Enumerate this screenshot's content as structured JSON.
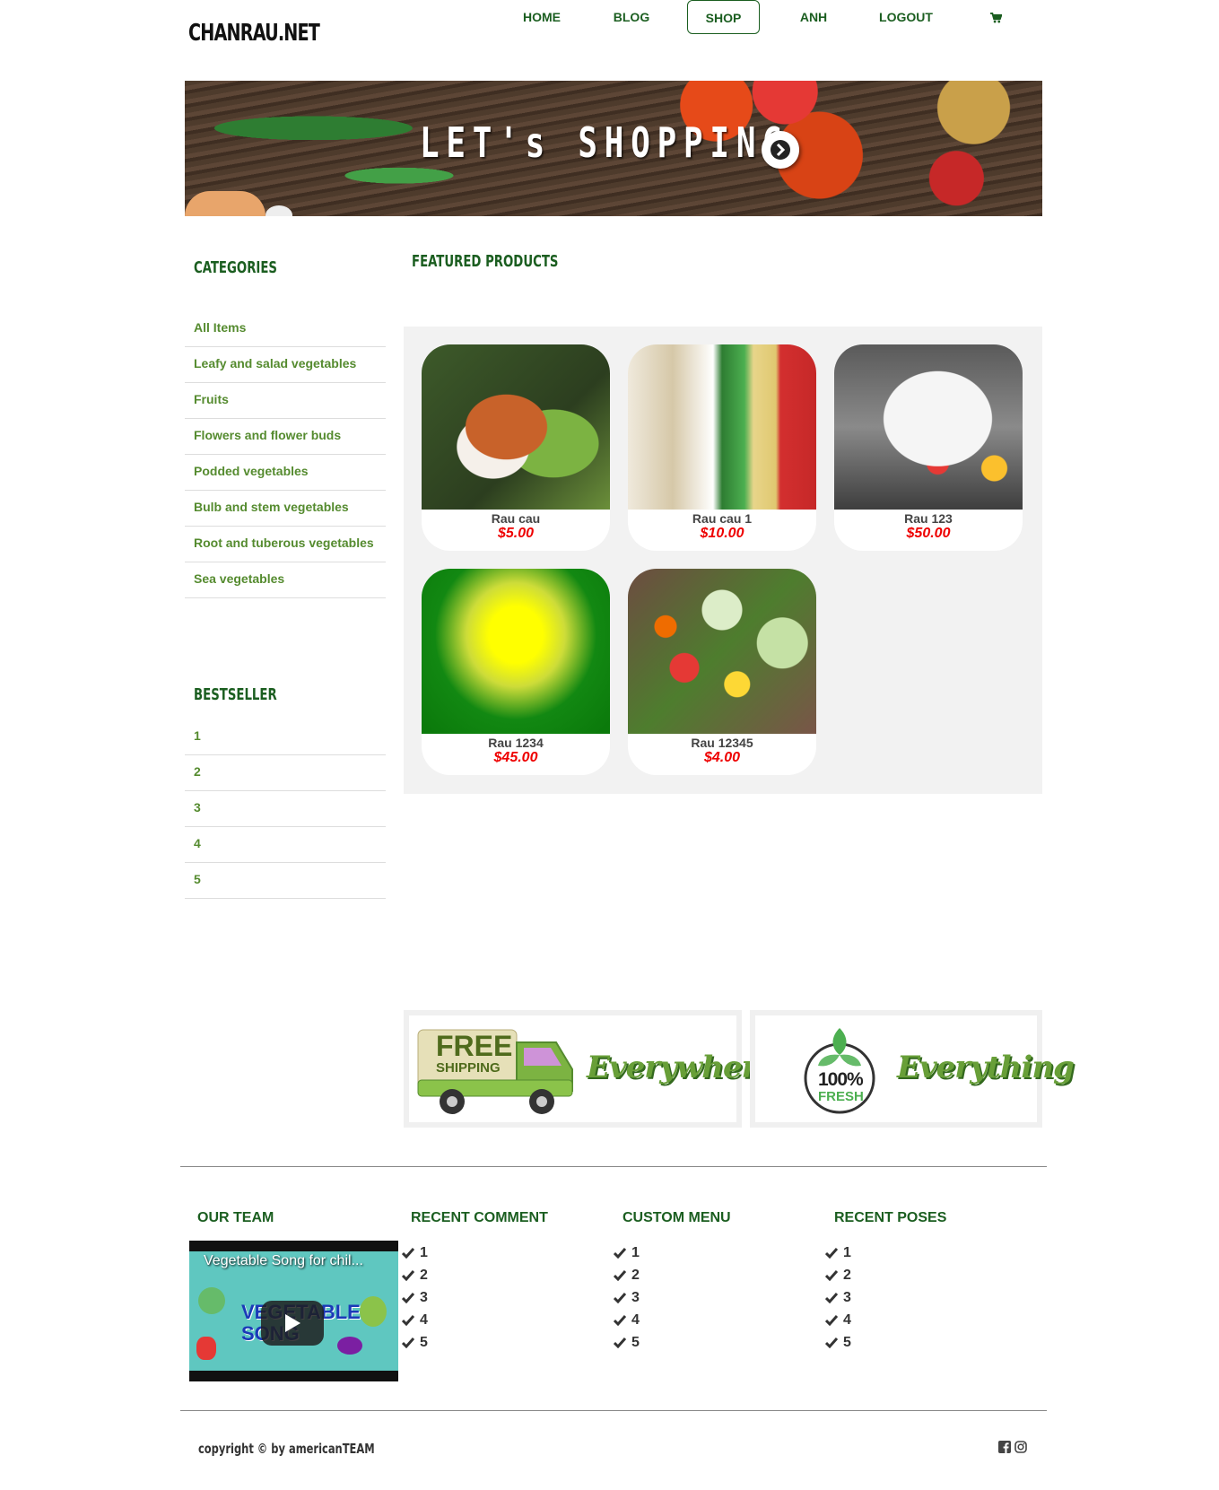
{
  "header": {
    "logo": "CHANRAU.NET",
    "nav": [
      {
        "label": "HOME"
      },
      {
        "label": "BLOG"
      },
      {
        "label": "SHOP",
        "active": true
      },
      {
        "label": "ANH"
      },
      {
        "label": "LOGOUT"
      }
    ],
    "cart_icon": "cart-icon"
  },
  "banner": {
    "text": "LET's SHOPPING",
    "button_icon": "chevron-right-icon"
  },
  "sidebar": {
    "categories_title": "CATEGORIES",
    "categories": [
      "All Items",
      "Leafy and salad vegetables",
      "Fruits",
      "Flowers and flower buds",
      "Podded vegetables",
      "Bulb and stem vegetables",
      "Root and tuberous vegetables",
      "Sea vegetables"
    ],
    "bestseller_title": "BESTSELLER",
    "bestsellers": [
      "1",
      "2",
      "3",
      "4",
      "5"
    ]
  },
  "featured": {
    "title": "FEATURED PRODUCTS",
    "products": [
      {
        "name": "Rau cau",
        "price": "$5.00"
      },
      {
        "name": "Rau cau 1",
        "price": "$10.00"
      },
      {
        "name": "Rau 123",
        "price": "$50.00"
      },
      {
        "name": "Rau 1234",
        "price": "$45.00"
      },
      {
        "name": "Rau 12345",
        "price": "$4.00"
      }
    ]
  },
  "promos": {
    "shipping": {
      "line1": "FREE",
      "line2": "SHIPPING",
      "word": "Everywhere"
    },
    "fresh": {
      "line1": "100%",
      "line2": "FRESH",
      "word": "Everything"
    }
  },
  "footer": {
    "our_team": {
      "title": "OUR TEAM",
      "video_title": "Vegetable Song for chil...",
      "video_overlay": "VEGETABLE SONG"
    },
    "recent_comment": {
      "title": "RECENT COMMENT",
      "items": [
        "1",
        "2",
        "3",
        "4",
        "5"
      ]
    },
    "custom_menu": {
      "title": "CUSTOM MENU",
      "items": [
        "1",
        "2",
        "3",
        "4",
        "5"
      ]
    },
    "recent_poses": {
      "title": "RECENT POSES",
      "items": [
        "1",
        "2",
        "3",
        "4",
        "5"
      ]
    },
    "copyright": "copyright © by americanTEAM",
    "social_icons": [
      "facebook-icon",
      "instagram-icon"
    ]
  },
  "colors": {
    "brand_green": "#1b5e20",
    "link_green": "#558b2f",
    "price_red": "#ee0000",
    "panel_gray": "#f2f2f2"
  }
}
